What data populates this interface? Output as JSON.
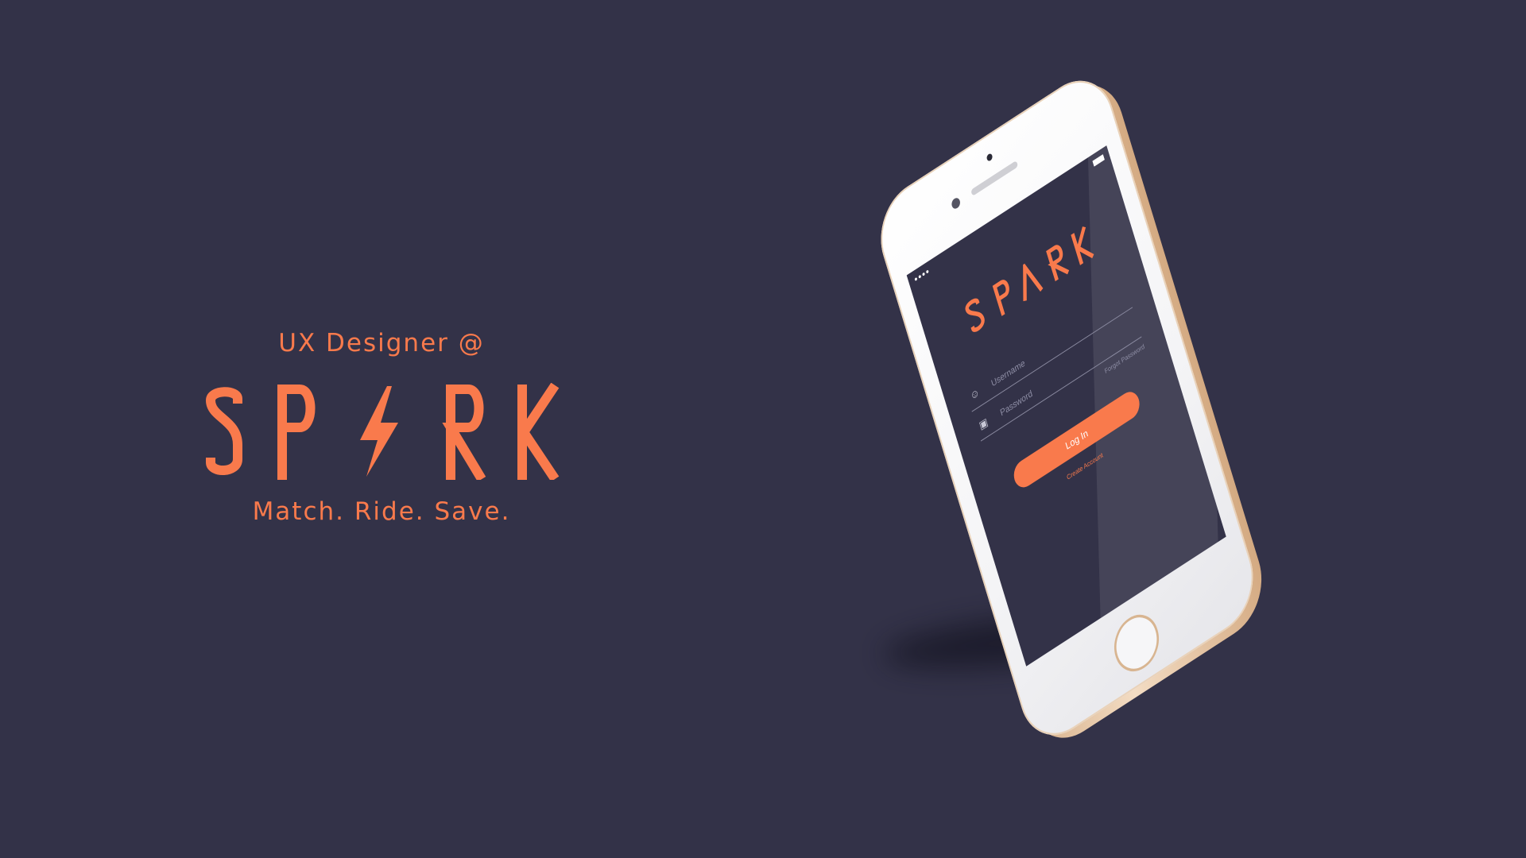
{
  "colors": {
    "background": "#333248",
    "accent": "#f97a4c",
    "phone_body": "#f4f4f6",
    "phone_frame": "#d9b48f"
  },
  "brand": {
    "eyebrow": "UX Designer @",
    "logo_text": "SPARK",
    "tagline": "Match. Ride. Save."
  },
  "app": {
    "logo_text": "SPARK",
    "status_signal": "●●●●",
    "username": {
      "placeholder": "Username",
      "value": "",
      "icon": "user-icon"
    },
    "password": {
      "placeholder": "Password",
      "value": "",
      "icon": "lock-icon"
    },
    "forgot_password": "Forgot Password",
    "login_label": "Log In",
    "create_account": "Create Account"
  }
}
